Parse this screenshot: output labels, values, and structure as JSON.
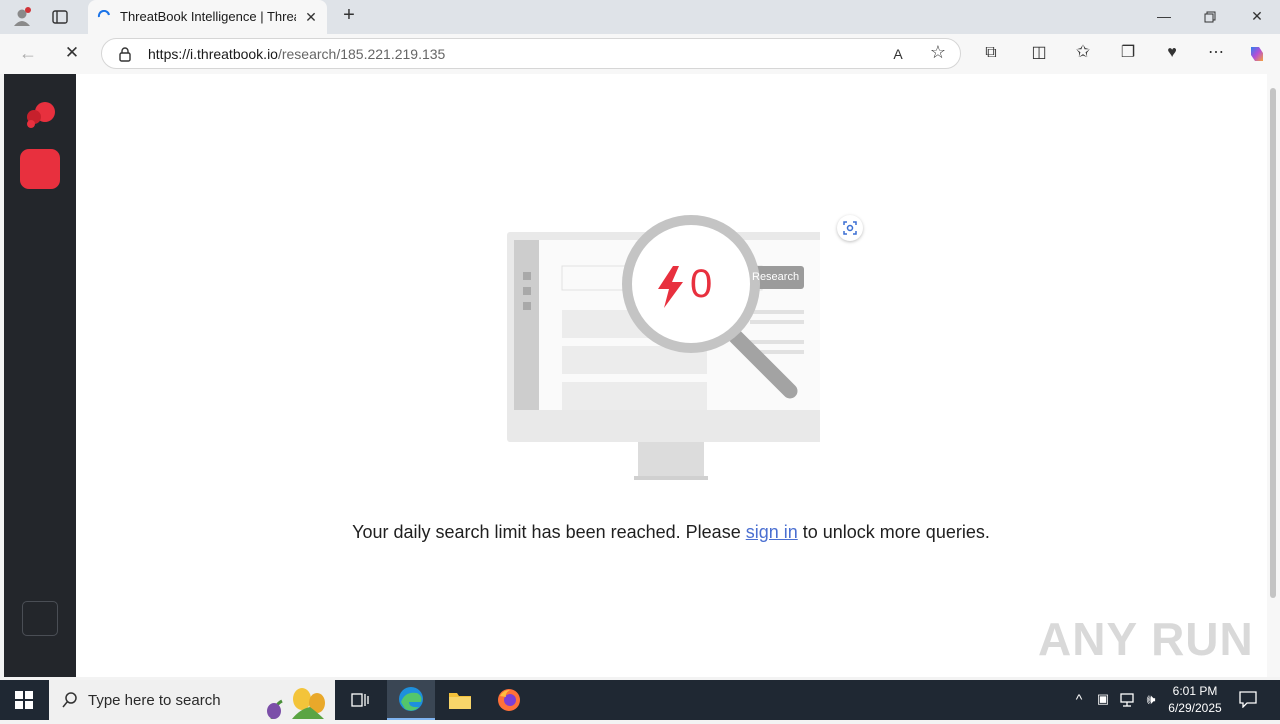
{
  "browser": {
    "tab_title": "ThreatBook Intelligence | ThreatB",
    "url_host": "https://i.threatbook.io",
    "url_path": "/research/185.221.219.135"
  },
  "content": {
    "illustration": {
      "count": "0",
      "search_label": "Research"
    },
    "message_before": "Your daily search limit has been reached. Please ",
    "sign_in_link": "sign in",
    "message_after": " to unlock more queries."
  },
  "taskbar": {
    "search_placeholder": "Type here to search",
    "time": "6:01 PM",
    "date": "6/29/2025"
  },
  "watermark": "ANY RUN",
  "colors": {
    "accent_red": "#e8303e",
    "rail": "#23262b",
    "link": "#4a6fd1"
  }
}
